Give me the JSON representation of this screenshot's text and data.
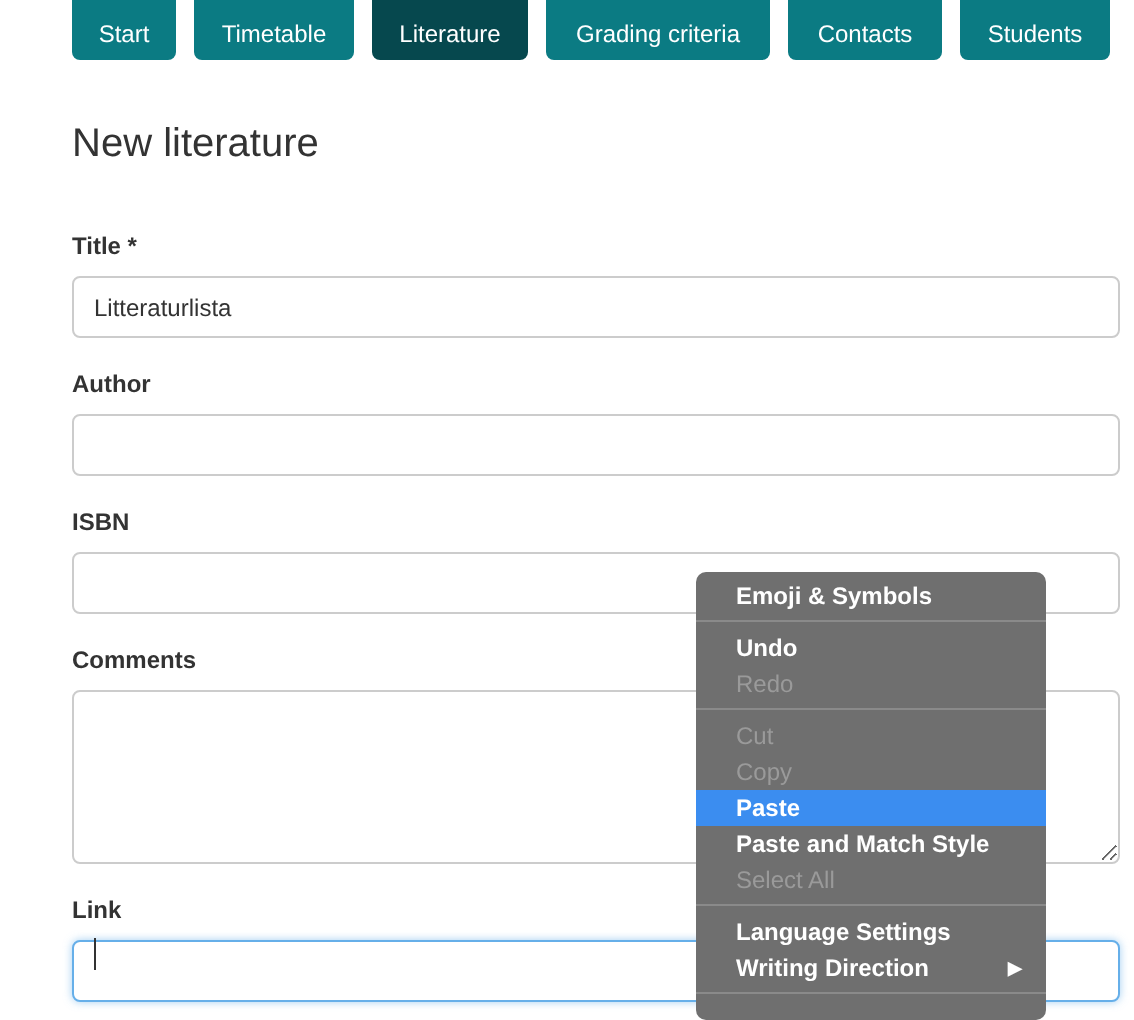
{
  "nav_tabs": [
    {
      "label": "Start",
      "selected": false
    },
    {
      "label": "Timetable",
      "selected": false
    },
    {
      "label": "Literature",
      "selected": true
    },
    {
      "label": "Grading criteria",
      "selected": false
    },
    {
      "label": "Contacts",
      "selected": false
    },
    {
      "label": "Students",
      "selected": false
    }
  ],
  "heading": "New literature",
  "fields": [
    {
      "label": "Title *",
      "kind": "input",
      "value": "Litteraturlista",
      "focused": false
    },
    {
      "label": "Author",
      "kind": "input",
      "focused": false
    },
    {
      "label": "ISBN",
      "kind": "input",
      "focused": false
    },
    {
      "label": "Comments",
      "kind": "textarea",
      "focused": false
    },
    {
      "label": "Link",
      "kind": "input",
      "focused": true
    }
  ],
  "context_menu": {
    "items": [
      {
        "kind": "item",
        "label": "Emoji & Symbols",
        "disabled": false,
        "selected": false
      },
      {
        "kind": "separator"
      },
      {
        "kind": "item",
        "label": "Undo",
        "disabled": false,
        "selected": false
      },
      {
        "kind": "item",
        "label": "Redo",
        "disabled": true,
        "selected": false
      },
      {
        "kind": "separator"
      },
      {
        "kind": "item",
        "label": "Cut",
        "disabled": true,
        "selected": false
      },
      {
        "kind": "item",
        "label": "Copy",
        "disabled": true,
        "selected": false
      },
      {
        "kind": "item",
        "label": "Paste",
        "disabled": false,
        "selected": true
      },
      {
        "kind": "item",
        "label": "Paste and Match Style",
        "disabled": false,
        "selected": false
      },
      {
        "kind": "item",
        "label": "Select All",
        "disabled": true,
        "selected": false
      },
      {
        "kind": "separator"
      },
      {
        "kind": "item",
        "label": "Language Settings",
        "disabled": false,
        "selected": false
      },
      {
        "kind": "item",
        "label": "Writing Direction",
        "disabled": false,
        "selected": false,
        "submenu": "▶"
      },
      {
        "kind": "separator"
      }
    ]
  }
}
